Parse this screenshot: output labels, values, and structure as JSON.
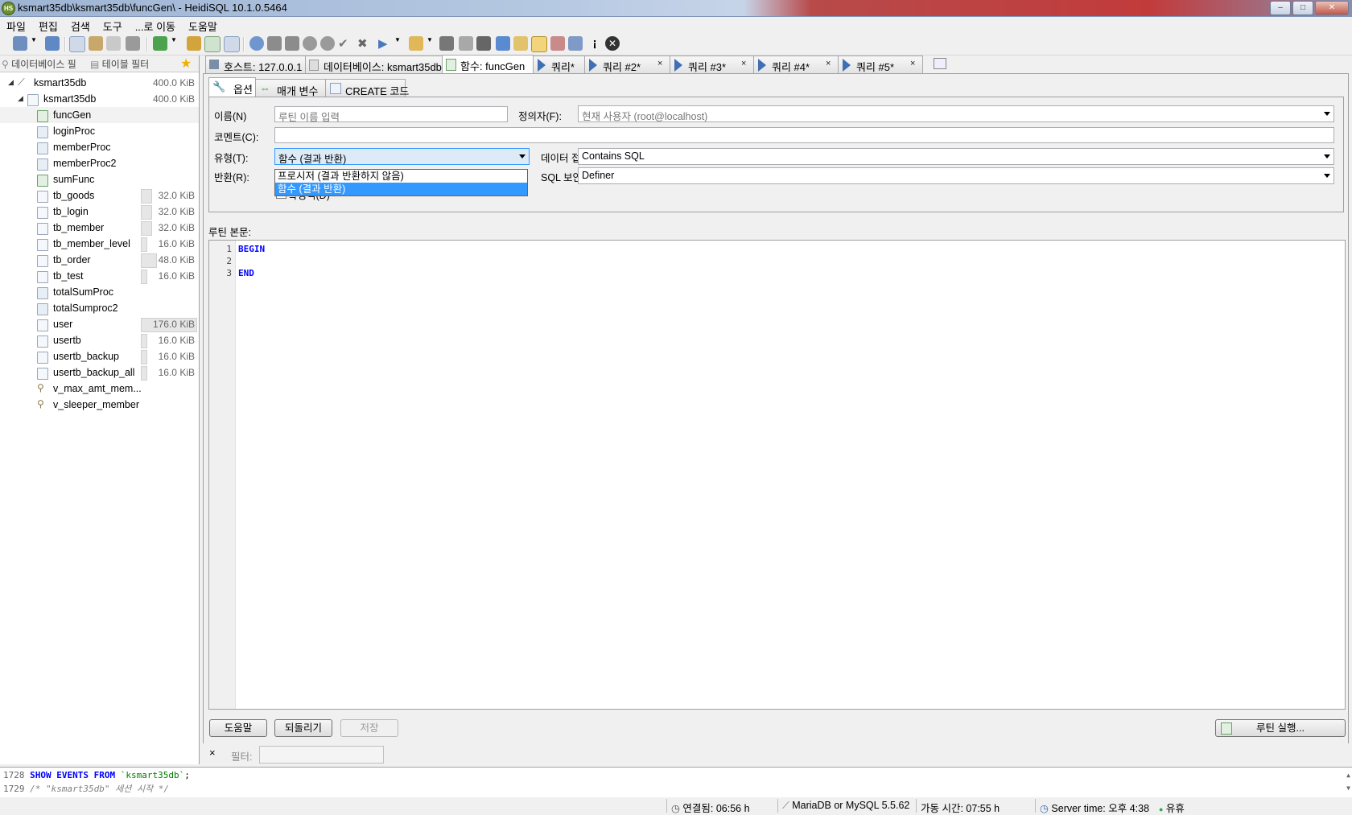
{
  "window": {
    "title": "ksmart35db\\ksmart35db\\funcGen\\ - HeidiSQL 10.1.0.5464"
  },
  "menu": [
    "파일",
    "편집",
    "검색",
    "도구",
    "...로 이동",
    "도움말"
  ],
  "left": {
    "db_filter": "데이터베이스 필",
    "table_filter": "테이블 필터",
    "tree": [
      {
        "name": "ksmart35db",
        "size": "400.0 KiB",
        "kind": "host"
      },
      {
        "name": "ksmart35db",
        "size": "400.0 KiB",
        "kind": "db"
      },
      {
        "name": "funcGen",
        "size": "",
        "kind": "func"
      },
      {
        "name": "loginProc",
        "size": "",
        "kind": "proc"
      },
      {
        "name": "memberProc",
        "size": "",
        "kind": "proc"
      },
      {
        "name": "memberProc2",
        "size": "",
        "kind": "proc"
      },
      {
        "name": "sumFunc",
        "size": "",
        "kind": "func"
      },
      {
        "name": "tb_goods",
        "size": "32.0 KiB",
        "kind": "table"
      },
      {
        "name": "tb_login",
        "size": "32.0 KiB",
        "kind": "table"
      },
      {
        "name": "tb_member",
        "size": "32.0 KiB",
        "kind": "table"
      },
      {
        "name": "tb_member_level",
        "size": "16.0 KiB",
        "kind": "table"
      },
      {
        "name": "tb_order",
        "size": "48.0 KiB",
        "kind": "table"
      },
      {
        "name": "tb_test",
        "size": "16.0 KiB",
        "kind": "table"
      },
      {
        "name": "totalSumProc",
        "size": "",
        "kind": "proc"
      },
      {
        "name": "totalSumproc2",
        "size": "",
        "kind": "proc"
      },
      {
        "name": "user",
        "size": "176.0 KiB",
        "kind": "table"
      },
      {
        "name": "usertb",
        "size": "16.0 KiB",
        "kind": "table"
      },
      {
        "name": "usertb_backup",
        "size": "16.0 KiB",
        "kind": "table"
      },
      {
        "name": "usertb_backup_all",
        "size": "16.0 KiB",
        "kind": "table"
      },
      {
        "name": "v_max_amt_mem...",
        "size": "",
        "kind": "view"
      },
      {
        "name": "v_sleeper_member",
        "size": "",
        "kind": "view"
      }
    ]
  },
  "tabs": {
    "host": "호스트: 127.0.0.1",
    "database": "데이터베이스: ksmart35db",
    "function": "함수: funcGen",
    "query1": "쿼리*",
    "query2": "쿼리 #2*",
    "query3": "쿼리 #3*",
    "query4": "쿼리 #4*",
    "query5": "쿼리 #5*",
    "close": "×"
  },
  "subtabs": {
    "options": "옵션",
    "params": "매개 변수",
    "create": "CREATE 코드"
  },
  "form": {
    "name_label": "이름(N)",
    "name_placeholder": "루틴 이름 입력",
    "definer_label": "정의자(F):",
    "definer_value": "현재 사용자 (root@localhost)",
    "comment_label": "코멘트(C):",
    "type_label": "유형(T):",
    "type_value": "함수 (결과 반환)",
    "type_options": [
      "프로시저 (결과 반환하지 않음)",
      "함수 (결과 반환)"
    ],
    "data_access_label": "데이터 접근(D)",
    "data_access_value": "Contains SQL",
    "returns_label": "반환(R):",
    "sql_security_label": "SQL 보안(C):",
    "sql_security_value": "Definer",
    "deterministic_label": "확정적(D)"
  },
  "body": {
    "label": "루틴 본문:",
    "lines": [
      {
        "n": "1",
        "text": "BEGIN"
      },
      {
        "n": "2",
        "text": ""
      },
      {
        "n": "3",
        "text": "END"
      }
    ]
  },
  "buttons": {
    "help": "도움말",
    "revert": "되돌리기",
    "save": "저장",
    "run": "루틴 실행..."
  },
  "filter": {
    "label": "필터:",
    "close": "×"
  },
  "log": [
    {
      "n": "1728",
      "kw": "SHOW EVENTS FROM",
      "str": "`ksmart35db`",
      "end": ";"
    },
    {
      "n": "1729",
      "comment": "/* \"ksmart35db\" 세션 시작 */"
    }
  ],
  "status": {
    "connected": "연결됨: 06:56 h",
    "server_type": "MariaDB or MySQL 5.5.62",
    "uptime": "가동 시간: 07:55 h",
    "server_time": "Server time: 오후 4:38",
    "idle": "유휴"
  },
  "colors": {
    "selection": "#3399ff",
    "keyword": "#0000ff",
    "string": "#008000"
  }
}
